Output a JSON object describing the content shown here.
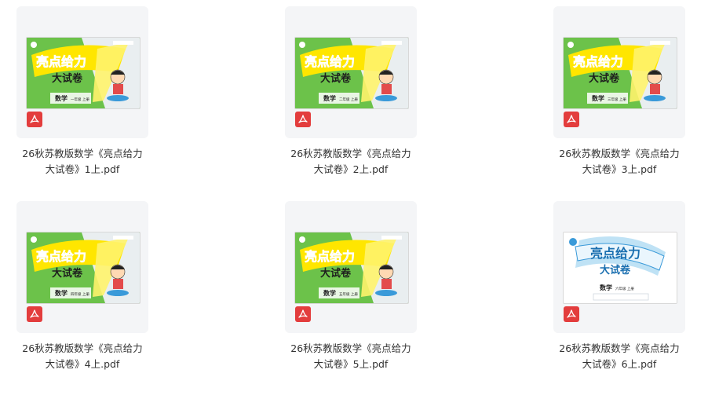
{
  "files": [
    {
      "line1": "26秋苏教版数学《亮点给力",
      "line2": "大试卷》1上.pdf",
      "cover_title": "亮点给力",
      "cover_subtitle": "大试卷",
      "subject": "数学",
      "grade": "一年级 上册",
      "style": "green"
    },
    {
      "line1": "26秋苏教版数学《亮点给力",
      "line2": "大试卷》2上.pdf",
      "cover_title": "亮点给力",
      "cover_subtitle": "大试卷",
      "subject": "数学",
      "grade": "二年级 上册",
      "style": "green"
    },
    {
      "line1": "26秋苏教版数学《亮点给力",
      "line2": "大试卷》3上.pdf",
      "cover_title": "亮点给力",
      "cover_subtitle": "大试卷",
      "subject": "数学",
      "grade": "三年级 上册",
      "style": "green"
    },
    {
      "line1": "26秋苏教版数学《亮点给力",
      "line2": "大试卷》4上.pdf",
      "cover_title": "亮点给力",
      "cover_subtitle": "大试卷",
      "subject": "数学",
      "grade": "四年级 上册",
      "style": "green"
    },
    {
      "line1": "26秋苏教版数学《亮点给力",
      "line2": "大试卷》5上.pdf",
      "cover_title": "亮点给力",
      "cover_subtitle": "大试卷",
      "subject": "数学",
      "grade": "五年级 上册",
      "style": "green"
    },
    {
      "line1": "26秋苏教版数学《亮点给力",
      "line2": "大试卷》6上.pdf",
      "cover_title": "亮点给力",
      "cover_subtitle": "大试卷",
      "subject": "数学",
      "grade": "六年级 上册",
      "style": "blue"
    }
  ],
  "colors": {
    "pdf_icon": "#e33d3d",
    "cover_green": "#6cc24a",
    "cover_yellow": "#ffe600",
    "cover_blue": "#3a9ad9"
  },
  "icons": {
    "file_type": "pdf-icon"
  }
}
